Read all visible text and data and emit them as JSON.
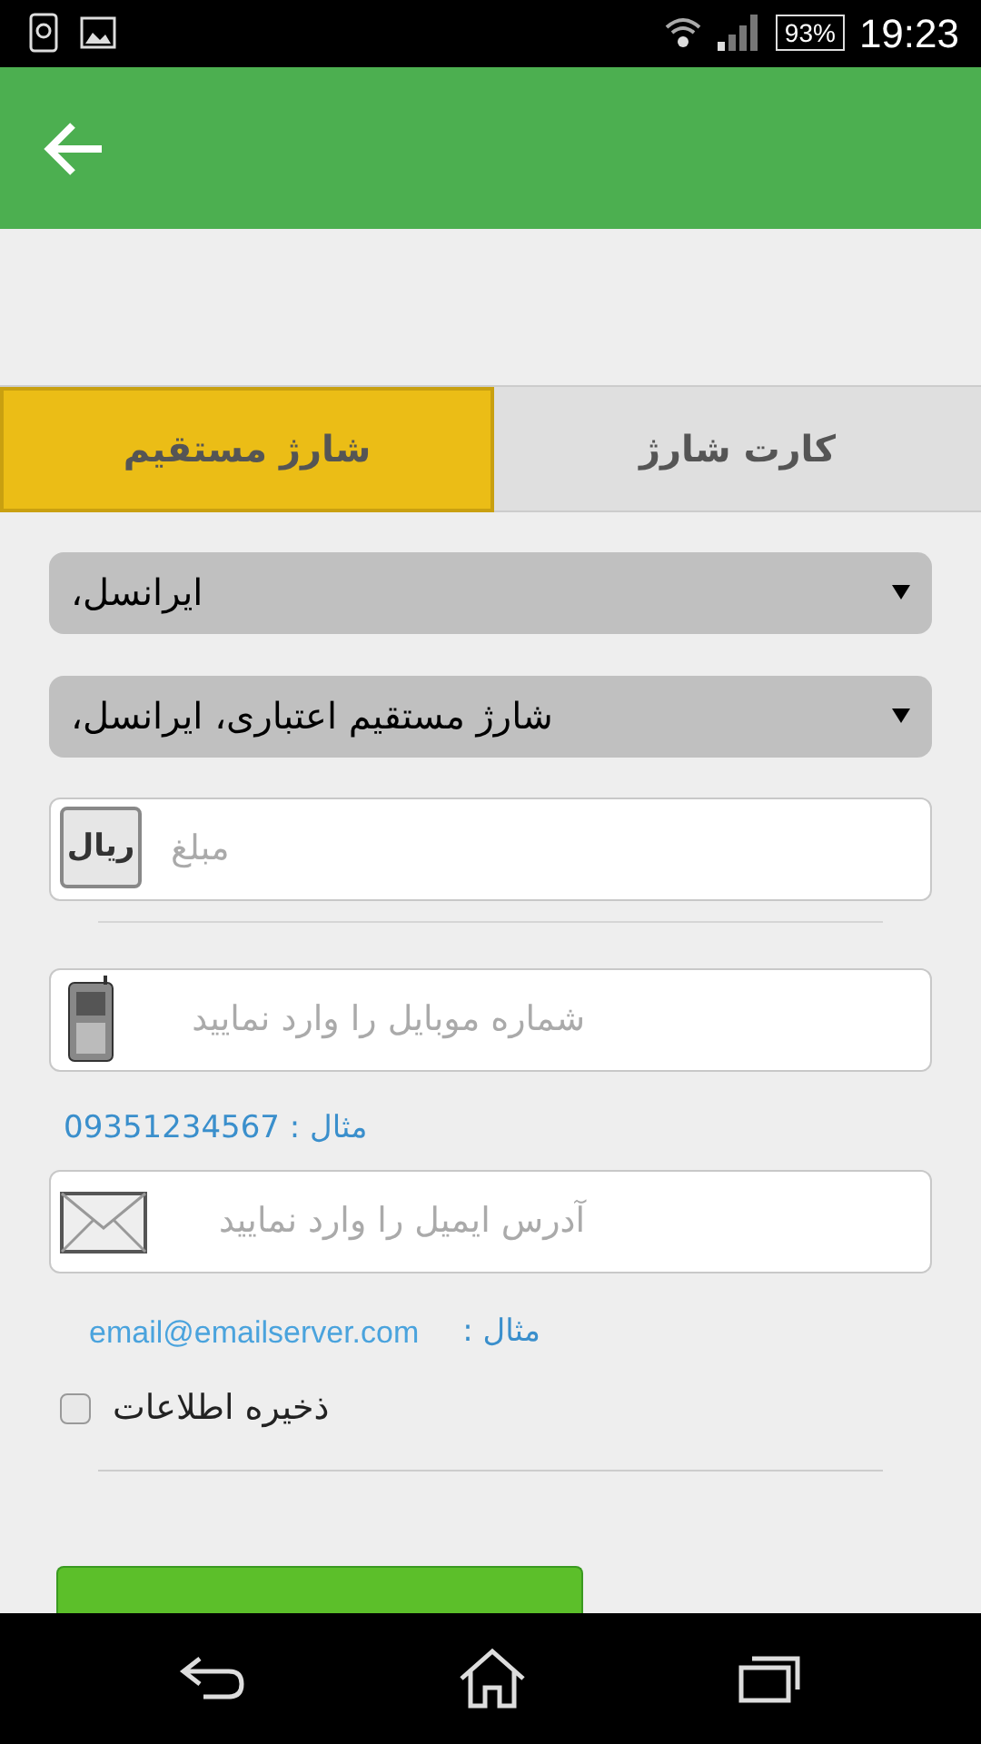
{
  "status_bar": {
    "battery": "93%",
    "time": "19:23"
  },
  "tabs": [
    {
      "label": "کارت شارژ",
      "selected": false
    },
    {
      "label": "شارژ مستقیم",
      "selected": true
    }
  ],
  "dropdowns": [
    {
      "value": "ایرانسل،"
    },
    {
      "value": "شارژ مستقیم اعتباری، ایرانسل،"
    }
  ],
  "amount_field": {
    "placeholder": "مبلغ",
    "unit": "ریال"
  },
  "mobile_field": {
    "placeholder": "شماره موبایل را وارد نمایید",
    "example": "مثال : 09351234567"
  },
  "email_field": {
    "placeholder": "آدرس ایمیل را وارد نمایید",
    "example_label": "مثال :",
    "example": "email@emailserver.com"
  },
  "save_checkbox": {
    "label": "ذخیره اطلاعات",
    "checked": false
  }
}
